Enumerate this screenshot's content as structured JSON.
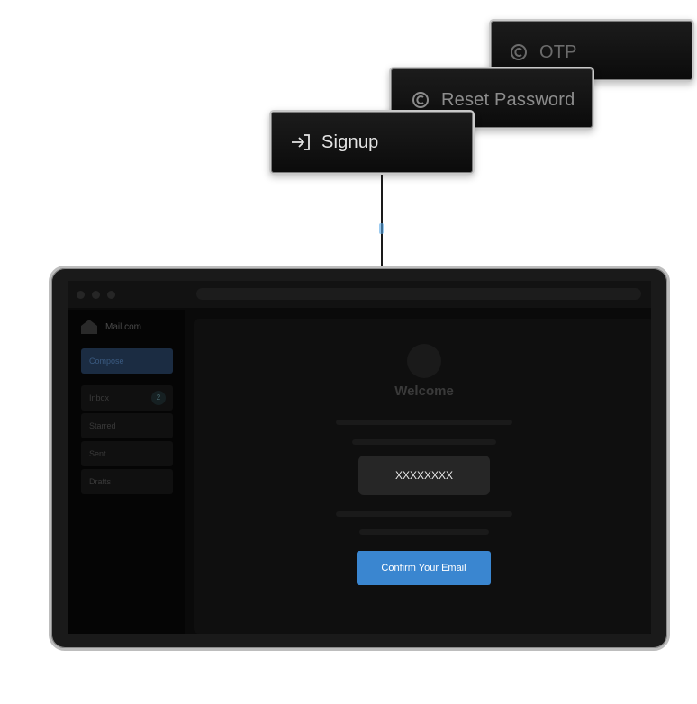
{
  "steps": {
    "otp": {
      "label": "OTP",
      "icon": "refresh-c-icon"
    },
    "reset": {
      "label": "Reset Password",
      "icon": "refresh-c-icon"
    },
    "signup": {
      "label": "Signup",
      "icon": "sign-in-arrow-icon"
    }
  },
  "app": {
    "brand": "Mail.com",
    "compose_label": "Compose",
    "nav": [
      {
        "label": "Inbox",
        "badge": "2"
      },
      {
        "label": "Starred"
      },
      {
        "label": "Sent"
      },
      {
        "label": "Drafts"
      }
    ]
  },
  "content": {
    "welcome": "Welcome",
    "code_value": "XXXXXXXX",
    "confirm_label": "Confirm Your Email"
  },
  "colors": {
    "accent": "#3a86d0",
    "card_bg": "#141414",
    "card_border": "#c9c9c9"
  }
}
